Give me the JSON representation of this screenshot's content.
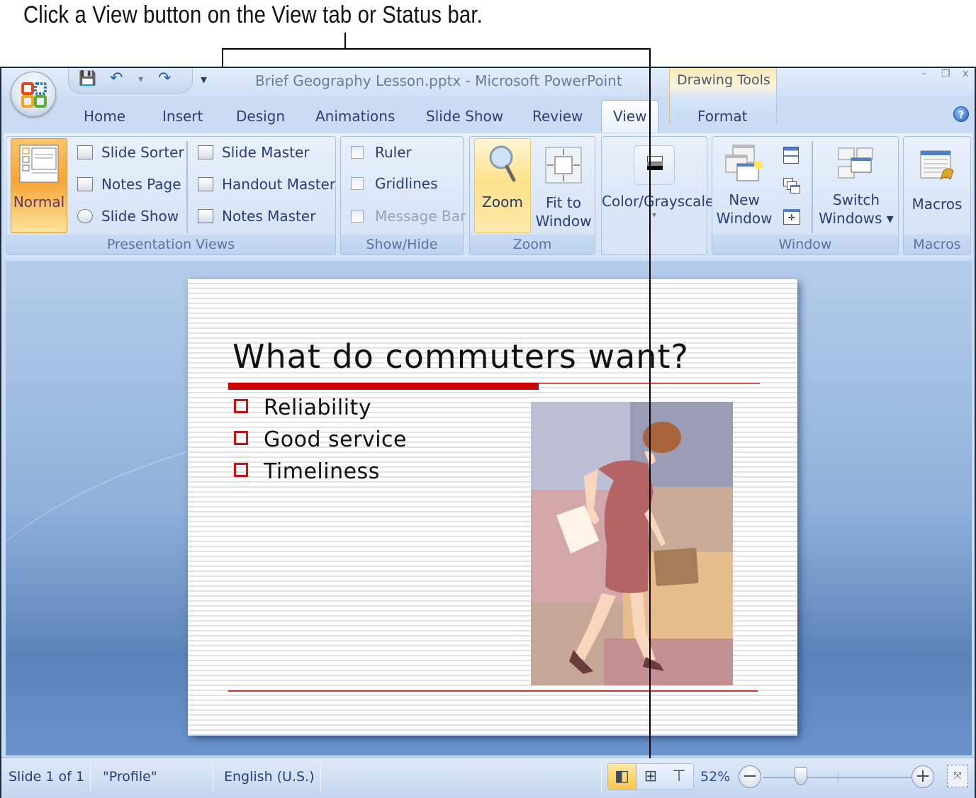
{
  "annotation": {
    "caption": "Click a View button on the View tab or Status bar."
  },
  "window": {
    "title": "Brief Geography Lesson.pptx - Microsoft PowerPoint",
    "contextual_tab_group": "Drawing Tools",
    "controls": {
      "minimize": "–",
      "restore": "❐",
      "close": "x"
    }
  },
  "quick_access": {
    "save_icon": "💾",
    "undo_icon": "↶",
    "undo_dropdown": "▾",
    "redo_icon": "↷",
    "customize_icon": "▾"
  },
  "tabs": [
    {
      "label": "Home"
    },
    {
      "label": "Insert"
    },
    {
      "label": "Design"
    },
    {
      "label": "Animations"
    },
    {
      "label": "Slide Show"
    },
    {
      "label": "Review"
    },
    {
      "label": "View",
      "active": true
    },
    {
      "label": "Format"
    }
  ],
  "help_icon": "?",
  "ribbon": {
    "presentation_views": {
      "label": "Presentation Views",
      "normal": "Normal",
      "slide_sorter": "Slide Sorter",
      "notes_page": "Notes Page",
      "slide_show": "Slide Show",
      "slide_master": "Slide Master",
      "handout_master": "Handout Master",
      "notes_master": "Notes Master"
    },
    "show_hide": {
      "label": "Show/Hide",
      "ruler": "Ruler",
      "gridlines": "Gridlines",
      "message_bar": "Message Bar"
    },
    "zoom": {
      "label": "Zoom",
      "zoom": "Zoom",
      "fit_line1": "Fit to",
      "fit_line2": "Window"
    },
    "color_grayscale": {
      "label": "Color/Grayscale",
      "dropdown": "▾"
    },
    "window": {
      "label": "Window",
      "new_line1": "New",
      "new_line2": "Window",
      "switch_line1": "Switch",
      "switch_line2": "Windows ▾"
    },
    "macros": {
      "label": "Macros",
      "macros": "Macros"
    }
  },
  "slide": {
    "title": "What do commuters want?",
    "bullets": [
      "Reliability",
      "Good service",
      "Timeliness"
    ],
    "accent_color": "#cc0000"
  },
  "statusbar": {
    "slide_info": "Slide 1 of 1",
    "theme": "\"Profile\"",
    "language": "English (U.S.)",
    "zoom_level": "52%",
    "zoom_out": "−",
    "zoom_in": "+",
    "zoom_slider_percent": 52,
    "view_normal_icon": "◧",
    "view_sorter_icon": "⊞",
    "view_show_icon": "⊤",
    "fit_icon": "⤧"
  }
}
